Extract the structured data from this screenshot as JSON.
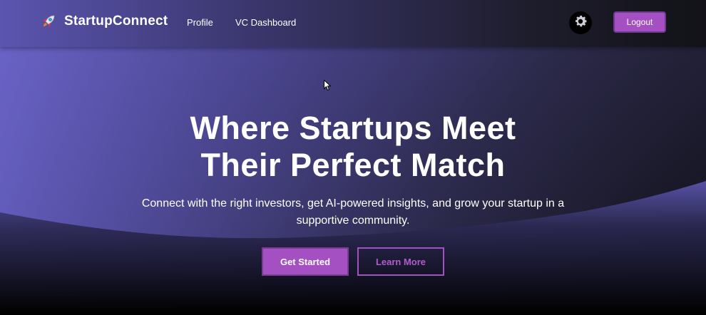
{
  "navbar": {
    "brand_name": "StartupConnect",
    "brand_icon": "rocket-icon",
    "links": [
      {
        "label": "Profile"
      },
      {
        "label": "VC Dashboard"
      }
    ],
    "settings_icon": "gear-icon",
    "logout_label": "Logout"
  },
  "hero": {
    "title_line1": "Where Startups Meet",
    "title_line2": "Their Perfect Match",
    "subtitle": "Connect with the right investors, get AI-powered insights, and grow your startup in a supportive community.",
    "primary_label": "Get Started",
    "secondary_label": "Learn More"
  },
  "colors": {
    "accent": "#a44fc2",
    "hero_gradient_start": "#6a63c4",
    "hero_gradient_end": "#0e0e14"
  }
}
